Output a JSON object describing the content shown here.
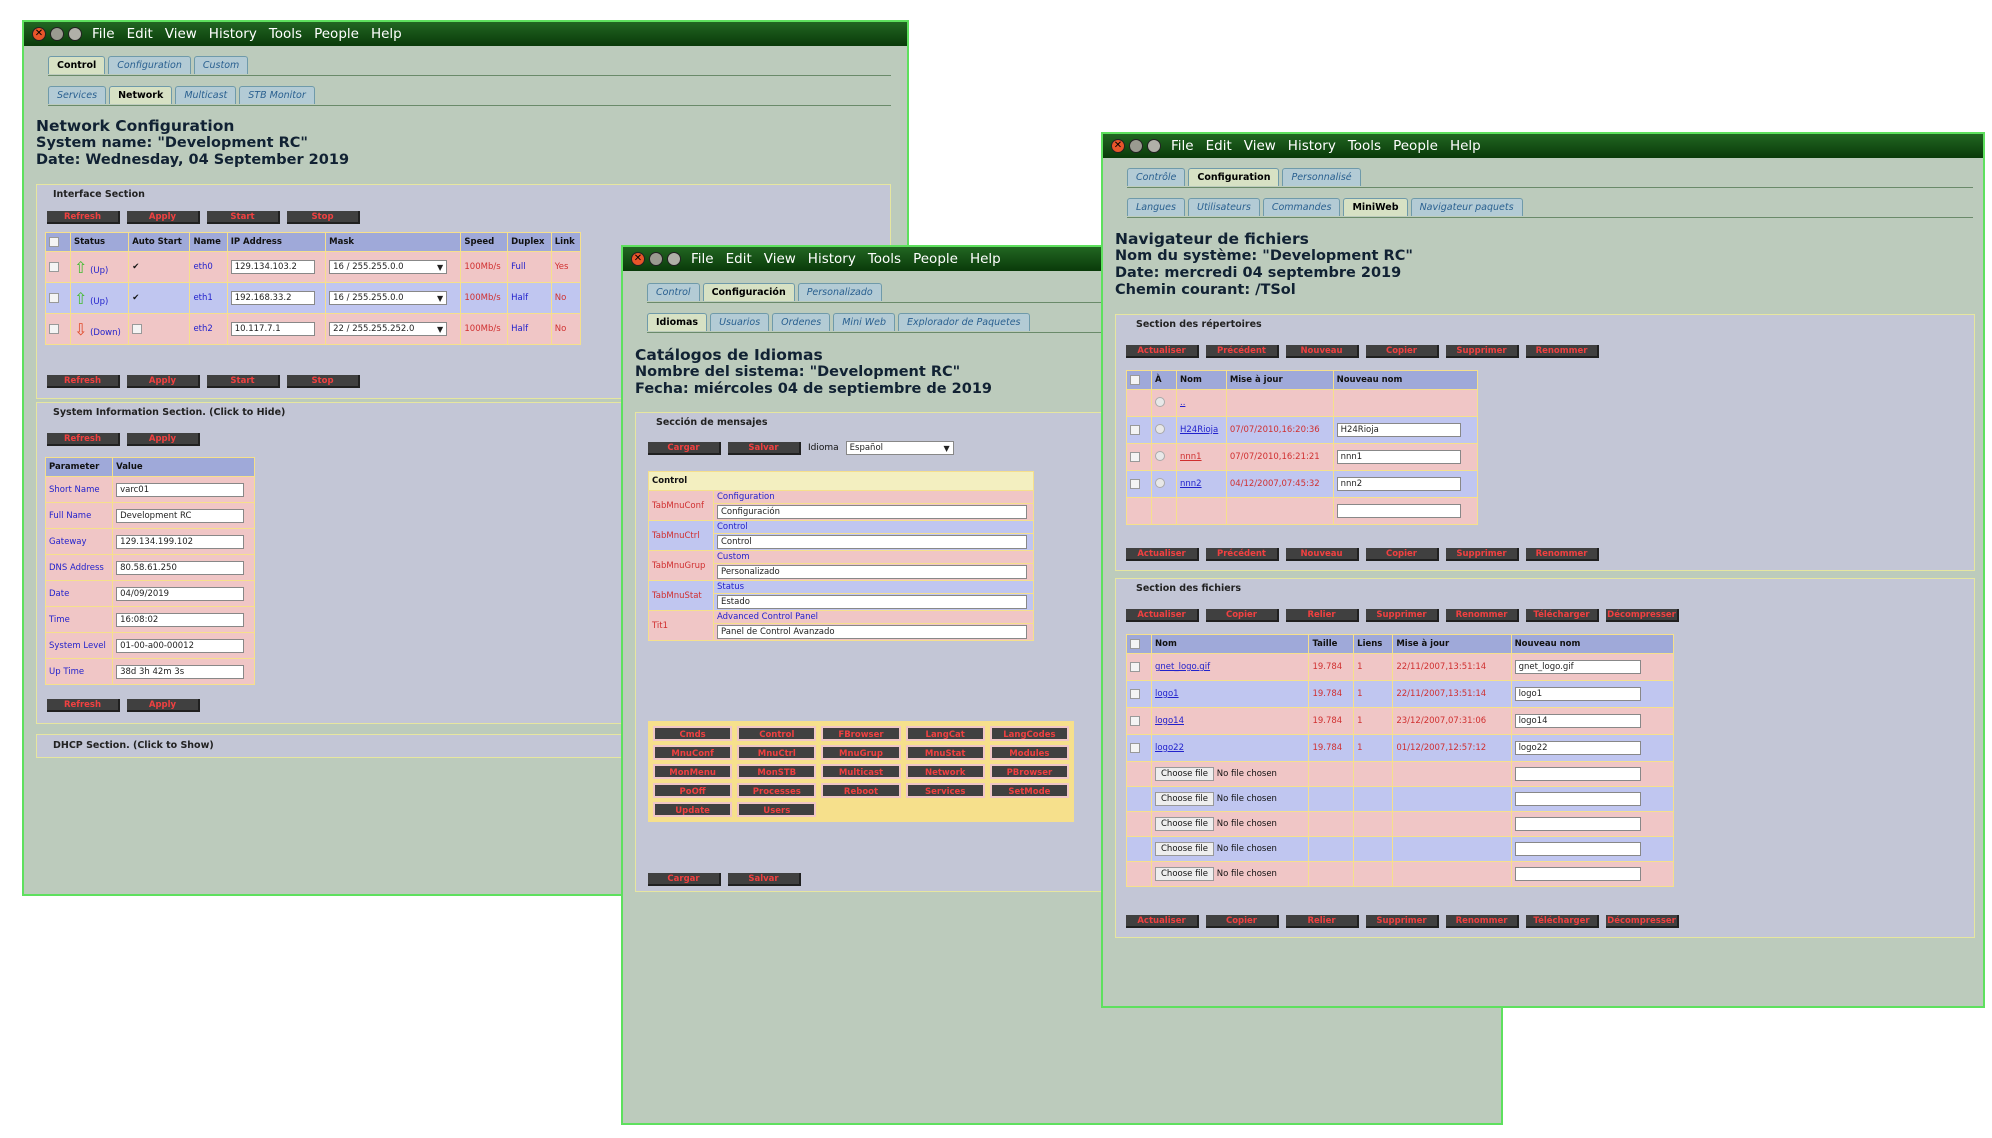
{
  "window1": {
    "menu": [
      "File",
      "Edit",
      "View",
      "History",
      "Tools",
      "People",
      "Help"
    ],
    "tabs1": [
      "Control",
      "Configuration",
      "Custom"
    ],
    "tabs2": [
      "Services",
      "Network",
      "Multicast",
      "STB Monitor"
    ],
    "title": "Network Configuration",
    "system_name": "System name: \"Development RC\"",
    "date": "Date: Wednesday, 04 September 2019",
    "interface_section": "Interface Section",
    "buttons": [
      "Refresh",
      "Apply",
      "Start",
      "Stop"
    ],
    "iface_headers": [
      "Status",
      "Auto Start",
      "Name",
      "IP Address",
      "Mask",
      "Speed",
      "Duplex",
      "Link"
    ],
    "ifaces": [
      {
        "status": "(Up)",
        "auto": "✔",
        "name": "eth0",
        "ip": "129.134.103.2",
        "mask": "16 / 255.255.0.0",
        "speed": "100Mb/s",
        "duplex": "Full",
        "link": "Yes"
      },
      {
        "status": "(Up)",
        "auto": "✔",
        "name": "eth1",
        "ip": "192.168.33.2",
        "mask": "16 / 255.255.0.0",
        "speed": "100Mb/s",
        "duplex": "Half",
        "link": "No"
      },
      {
        "status": "(Down)",
        "auto": "",
        "name": "eth2",
        "ip": "10.117.7.1",
        "mask": "22 / 255.255.252.0",
        "speed": "100Mb/s",
        "duplex": "Half",
        "link": "No"
      }
    ],
    "sysinfo_section": "System Information Section. (Click to Hide)",
    "sysinfo_buttons": [
      "Refresh",
      "Apply"
    ],
    "param_headers": [
      "Parameter",
      "Value"
    ],
    "params": [
      {
        "k": "Short Name",
        "v": "varc01"
      },
      {
        "k": "Full Name",
        "v": "Development RC"
      },
      {
        "k": "Gateway",
        "v": "129.134.199.102"
      },
      {
        "k": "DNS Address",
        "v": "80.58.61.250"
      },
      {
        "k": "Date",
        "v": "04/09/2019"
      },
      {
        "k": "Time",
        "v": "16:08:02"
      },
      {
        "k": "System Level",
        "v": "01-00-a00-00012"
      },
      {
        "k": "Up Time",
        "v": "38d 3h 42m 3s"
      }
    ],
    "dhcp_section": "DHCP Section. (Click to Show)"
  },
  "window2": {
    "menu": [
      "File",
      "Edit",
      "View",
      "History",
      "Tools",
      "People",
      "Help"
    ],
    "tabs1": [
      "Control",
      "Configuración",
      "Personalizado"
    ],
    "tabs2": [
      "Idiomas",
      "Usuarios",
      "Ordenes",
      "Mini Web",
      "Explorador de Paquetes"
    ],
    "title": "Catálogos de Idiomas",
    "system_name": "Nombre del sistema: \"Development RC\"",
    "date": "Fecha: miércoles 04 de septiembre de 2019",
    "msg_section": "Sección de mensajes",
    "buttons": [
      "Cargar",
      "Salvar"
    ],
    "lang_label": "Idioma",
    "lang_value": "Español",
    "control_header": "Control",
    "entries": [
      {
        "key": "TabMnuConf",
        "orig": "Configuration",
        "value": "Configuración"
      },
      {
        "key": "TabMnuCtrl",
        "orig": "Control",
        "value": "Control"
      },
      {
        "key": "TabMnuGrup",
        "orig": "Custom",
        "value": "Personalizado"
      },
      {
        "key": "TabMnuStat",
        "orig": "Status",
        "value": "Estado"
      },
      {
        "key": "Tit1",
        "orig": "Advanced Control Panel",
        "value": "Panel de Control Avanzado"
      }
    ],
    "catalog_buttons": [
      "Cmds",
      "Control",
      "FBrowser",
      "LangCat",
      "LangCodes",
      "MnuConf",
      "MnuCtrl",
      "MnuGrup",
      "MnuStat",
      "Modules",
      "MonMenu",
      "MonSTB",
      "Multicast",
      "Network",
      "PBrowser",
      "PoOff",
      "Processes",
      "Reboot",
      "Services",
      "SetMode",
      "Update",
      "Users"
    ]
  },
  "window3": {
    "menu": [
      "File",
      "Edit",
      "View",
      "History",
      "Tools",
      "People",
      "Help"
    ],
    "tabs1": [
      "Contrôle",
      "Configuration",
      "Personnalisé"
    ],
    "tabs2": [
      "Langues",
      "Utilisateurs",
      "Commandes",
      "MiniWeb",
      "Navigateur paquets"
    ],
    "title": "Navigateur de fichiers",
    "system_name": "Nom du système: \"Development RC\"",
    "date": "Date: mercredi 04 septembre 2019",
    "path": "Chemin courant: /TSol",
    "dir_section": "Section des répertoires",
    "dir_buttons": [
      "Actualiser",
      "Précédent",
      "Nouveau",
      "Copier",
      "Supprimer",
      "Renommer"
    ],
    "dir_headers": [
      "À",
      "Nom",
      "Mise à jour",
      "Nouveau nom"
    ],
    "dirs": [
      {
        "name": "..",
        "date": "",
        "new": ""
      },
      {
        "name": "H24Rioja",
        "date": "07/07/2010,16:20:36",
        "new": "H24Rioja"
      },
      {
        "name": "nnn1",
        "date": "07/07/2010,16:21:21",
        "new": "nnn1"
      },
      {
        "name": "nnn2",
        "date": "04/12/2007,07:45:32",
        "new": "nnn2"
      }
    ],
    "file_section": "Section des fichiers",
    "file_buttons": [
      "Actualiser",
      "Copier",
      "Relier",
      "Supprimer",
      "Renommer",
      "Télécharger",
      "Décompresser"
    ],
    "file_headers": [
      "Nom",
      "Taille",
      "Liens",
      "Mise à jour",
      "Nouveau nom"
    ],
    "files": [
      {
        "name": "gnet_logo.gif",
        "size": "19.784",
        "links": "1",
        "date": "22/11/2007,13:51:14",
        "new": "gnet_logo.gif"
      },
      {
        "name": "logo1",
        "size": "19.784",
        "links": "1",
        "date": "22/11/2007,13:51:14",
        "new": "logo1"
      },
      {
        "name": "logo14",
        "size": "19.784",
        "links": "1",
        "date": "23/12/2007,07:31:06",
        "new": "logo14"
      },
      {
        "name": "logo22",
        "size": "19.784",
        "links": "1",
        "date": "01/12/2007,12:57:12",
        "new": "logo22"
      }
    ],
    "choose_file": "Choose file",
    "no_file": "No file chosen"
  }
}
